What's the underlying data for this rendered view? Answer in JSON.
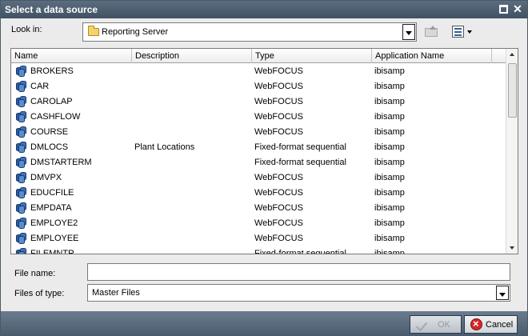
{
  "dialog": {
    "title": "Select a data source"
  },
  "lookin": {
    "label": "Look in:",
    "value": "Reporting Server"
  },
  "columns": [
    "Name",
    "Description",
    "Type",
    "Application Name"
  ],
  "rows": [
    {
      "name": "BROKERS",
      "description": "",
      "type": "WebFOCUS",
      "app": "ibisamp"
    },
    {
      "name": "CAR",
      "description": "",
      "type": "WebFOCUS",
      "app": "ibisamp"
    },
    {
      "name": "CAROLAP",
      "description": "",
      "type": "WebFOCUS",
      "app": "ibisamp"
    },
    {
      "name": "CASHFLOW",
      "description": "",
      "type": "WebFOCUS",
      "app": "ibisamp"
    },
    {
      "name": "COURSE",
      "description": "",
      "type": "WebFOCUS",
      "app": "ibisamp"
    },
    {
      "name": "DMLOCS",
      "description": "Plant Locations",
      "type": "Fixed-format sequential",
      "app": "ibisamp"
    },
    {
      "name": "DMSTARTERM",
      "description": "",
      "type": "Fixed-format sequential",
      "app": "ibisamp"
    },
    {
      "name": "DMVPX",
      "description": "",
      "type": "WebFOCUS",
      "app": "ibisamp"
    },
    {
      "name": "EDUCFILE",
      "description": "",
      "type": "WebFOCUS",
      "app": "ibisamp"
    },
    {
      "name": "EMPDATA",
      "description": "",
      "type": "WebFOCUS",
      "app": "ibisamp"
    },
    {
      "name": "EMPLOYE2",
      "description": "",
      "type": "WebFOCUS",
      "app": "ibisamp"
    },
    {
      "name": "EMPLOYEE",
      "description": "",
      "type": "WebFOCUS",
      "app": "ibisamp"
    },
    {
      "name": "FILEMNTR",
      "description": "",
      "type": "Fixed-format sequential",
      "app": "ibisamp"
    }
  ],
  "filename": {
    "label": "File name:",
    "value": ""
  },
  "filetype": {
    "label": "Files of type:",
    "value": "Master Files"
  },
  "buttons": {
    "ok": "OK",
    "cancel": "Cancel"
  },
  "icons": {
    "folder": "folder-icon",
    "up": "up-folder-icon",
    "view": "view-menu-icon",
    "db": "database-icon"
  }
}
